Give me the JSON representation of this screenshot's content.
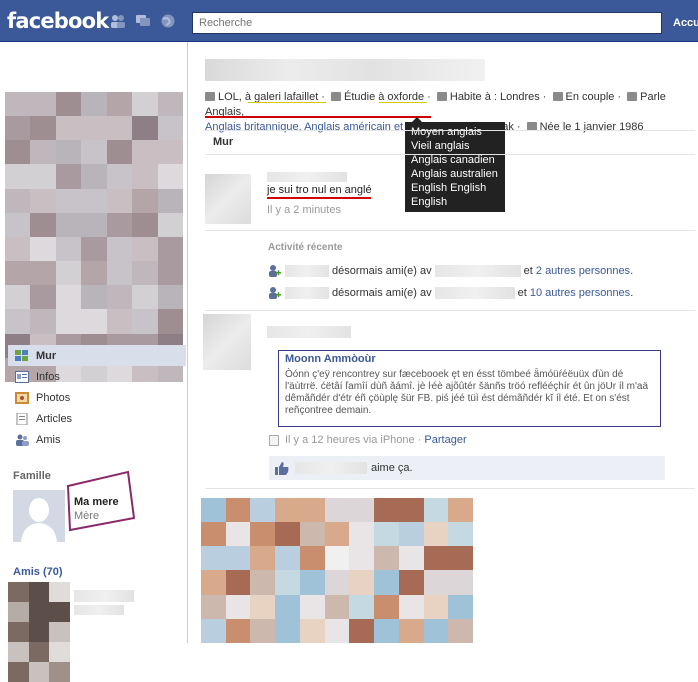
{
  "header": {
    "logo": "facebook",
    "search_placeholder": "Recherche",
    "account_label": "Accu"
  },
  "sidebar": {
    "nav": [
      {
        "label": "Mur",
        "icon": "wall-icon",
        "active": true
      },
      {
        "label": "Infos",
        "icon": "info-icon"
      },
      {
        "label": "Photos",
        "icon": "photos-icon"
      },
      {
        "label": "Articles",
        "icon": "notes-icon"
      },
      {
        "label": "Amis",
        "icon": "friends-icon"
      }
    ],
    "family_label": "Famille",
    "family_member": {
      "name": "Ma mere",
      "relation": "Mère"
    },
    "friends_label": "Amis (70)"
  },
  "profile": {
    "info": {
      "work": "LOL, à galeri lafaillet",
      "study": "Étudie à oxforde",
      "lives": "Habite à : Londres",
      "relationship": "En couple",
      "languages_prefix": "Parle Anglais,",
      "languages_more": "Anglais britannique, Anglais américain et 6 autres",
      "from": "De Usak",
      "born": "Née le 1 janvier 1986"
    },
    "languages_tooltip": [
      "Moyen anglais",
      "Vieil anglais",
      "Anglais canadien",
      "Anglais australien",
      "English English",
      "English"
    ]
  },
  "wall": {
    "tab_label": "Mur",
    "post1": {
      "text": "je sui tro nul en anglé",
      "time": "Il y a 2 minutes"
    },
    "recent_activity_label": "Activité récente",
    "activities": [
      {
        "text": "désormais ami(e) av",
        "suffix_prefix": "et",
        "link": "2 autres personnes",
        "end": "."
      },
      {
        "text": "désormais ami(e) av",
        "suffix_prefix": "et",
        "link": "10 autres personnes",
        "end": "."
      }
    ],
    "post2": {
      "note_title": "Moonn Ammòoùr",
      "note_body": "Òónn ç'eÿ rencontrey sur fæcebooek ęt ɐn ésst tömbeé ǟmóüŕéëuüx ďùn dé l'äùtrrë. ćëtâí ľamîí dùñ ǎámî. jè ŀéè ajõûtér šänñs tröó reflééçhír ét ûn jöUr íl m'aä dêmãñdér d'étr éñ çöùplę šür FB. piś jéé tüì ést démãñdér kĭ íl été. Et on s'ést reñçontree demain.",
      "meta": "Il y a 12 heures via iPhone",
      "share": "Partager",
      "likes": "aime ça."
    }
  },
  "colors": {
    "brand": "#3b5998",
    "annotation_red": "#d10000",
    "annotation_purple": "#8a2a6a",
    "annotation_navy": "#2a2a7a"
  }
}
